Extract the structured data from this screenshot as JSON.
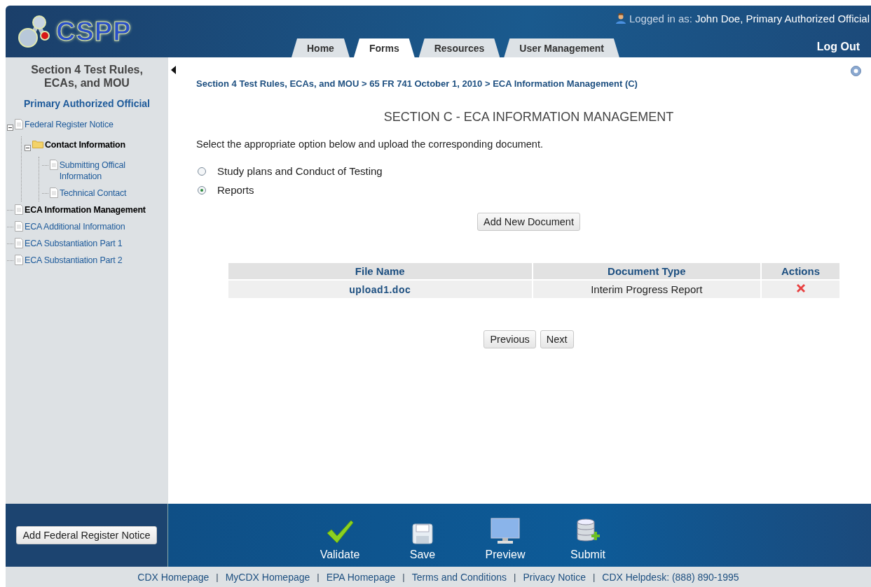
{
  "header": {
    "logo": "CSPP",
    "login_label": "Logged in as:",
    "login_user": "John Doe, Primary Authorized Official",
    "logout": "Log Out",
    "tabs": [
      {
        "label": "Home",
        "selected": false
      },
      {
        "label": "Forms",
        "selected": true
      },
      {
        "label": "Resources",
        "selected": false
      },
      {
        "label": "User Management",
        "selected": false
      }
    ]
  },
  "sidebar": {
    "title": "Section 4 Test Rules, ECAs, and MOU",
    "role": "Primary Authorized Official",
    "tree": [
      {
        "label": "Federal Register Notice",
        "kind": "page",
        "selected": false,
        "expanded": true,
        "children": [
          {
            "label": "Contact Information",
            "kind": "folder",
            "selected": false,
            "expanded": true,
            "children": [
              {
                "label": "Submitting Offical Information",
                "kind": "page",
                "selected": false
              },
              {
                "label": "Technical Contact",
                "kind": "page",
                "selected": false
              }
            ]
          }
        ]
      },
      {
        "label": "ECA Information Management",
        "kind": "page",
        "selected": true
      },
      {
        "label": "ECA Additional Information",
        "kind": "page",
        "selected": false
      },
      {
        "label": "ECA Substantiation Part 1",
        "kind": "page",
        "selected": false
      },
      {
        "label": "ECA Substantiation Part 2",
        "kind": "page",
        "selected": false
      }
    ],
    "button": "Add Federal Register Notice"
  },
  "content": {
    "breadcrumb": "Section 4 Test Rules, ECAs, and MOU > 65 FR 741 October 1, 2010 > ECA Information Management (C)",
    "heading": "SECTION C - ECA INFORMATION MANAGEMENT",
    "instruction": "Select the appropriate option below and upload the corresponding document.",
    "options": [
      {
        "label": "Study plans and Conduct of Testing",
        "selected": false
      },
      {
        "label": "Reports",
        "selected": true
      }
    ],
    "add_button": "Add New Document",
    "table": {
      "columns": [
        "File Name",
        "Document Type",
        "Actions"
      ],
      "rows": [
        {
          "file_name": "upload1.doc",
          "document_type": "Interim Progress Report"
        }
      ]
    },
    "nav_buttons": [
      "Previous",
      "Next"
    ]
  },
  "actions": [
    {
      "kind": "validate",
      "label": "Validate"
    },
    {
      "kind": "save",
      "label": "Save"
    },
    {
      "kind": "preview",
      "label": "Preview"
    },
    {
      "kind": "submit",
      "label": "Submit"
    }
  ],
  "footer": [
    {
      "kind": "link",
      "text": "CDX Homepage"
    },
    {
      "kind": "separator",
      "text": "|"
    },
    {
      "kind": "link",
      "text": "MyCDX Homepage"
    },
    {
      "kind": "separator",
      "text": "|"
    },
    {
      "kind": "link",
      "text": "EPA Homepage"
    },
    {
      "kind": "separator",
      "text": "|"
    },
    {
      "kind": "link",
      "text": "Terms and Conditions"
    },
    {
      "kind": "separator",
      "text": "|"
    },
    {
      "kind": "link",
      "text": "Privacy Notice"
    },
    {
      "kind": "separator",
      "text": "|"
    },
    {
      "kind": "link",
      "text": "CDX Helpdesk: (888) 890-1995"
    }
  ]
}
